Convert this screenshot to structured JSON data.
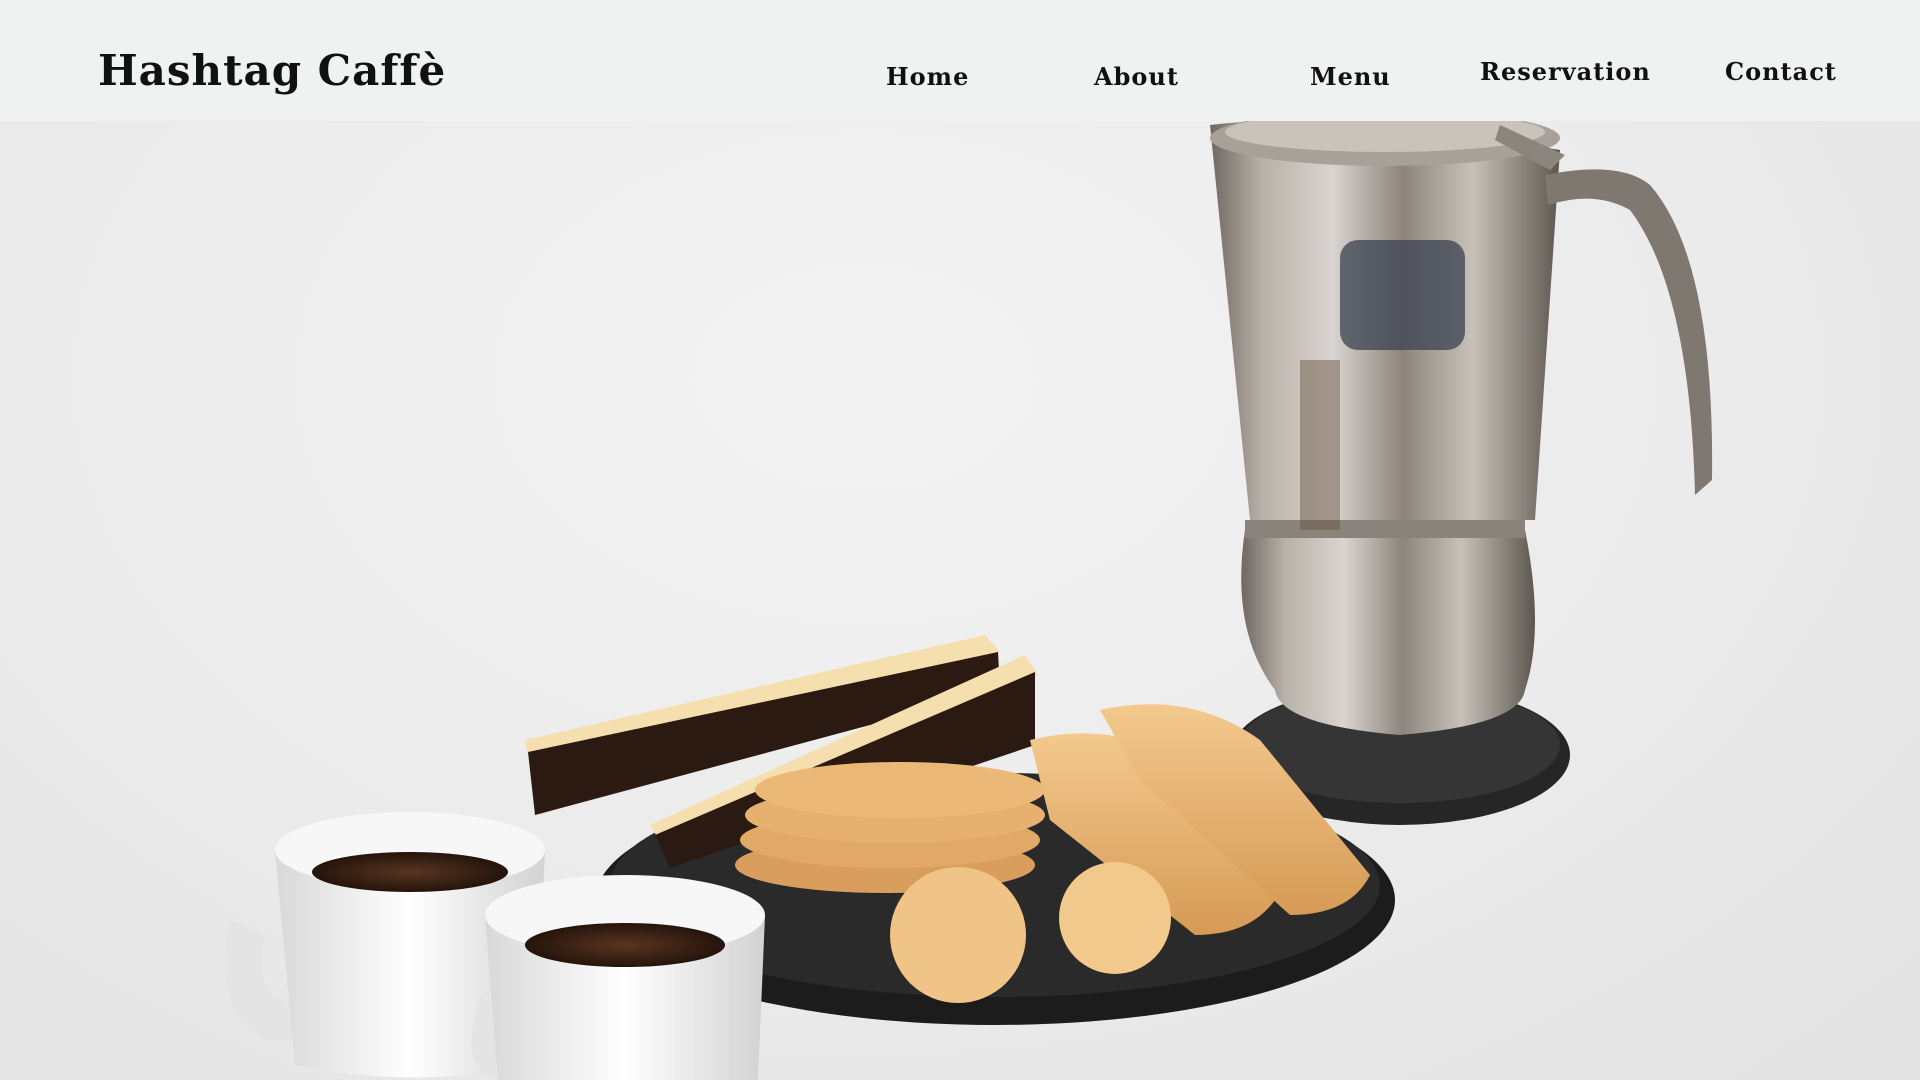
{
  "brand": {
    "name": "Hashtag Caffè"
  },
  "nav": {
    "items": [
      {
        "label": "Home"
      },
      {
        "label": "About"
      },
      {
        "label": "Menu"
      },
      {
        "label": "Reservation"
      },
      {
        "label": "Contact"
      }
    ]
  },
  "hero": {
    "image_subject": "espresso cups, biscotti plate and moka pot"
  },
  "colors": {
    "nav_bg": "#f0f1f1",
    "text": "#111111",
    "background": "#ececec"
  }
}
